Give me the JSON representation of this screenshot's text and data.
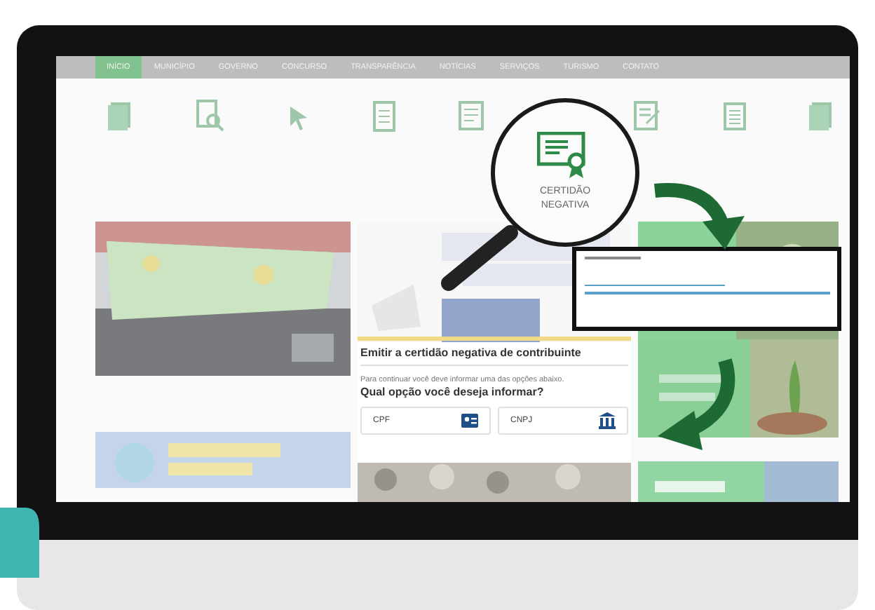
{
  "nav": [
    {
      "label": "INÍCIO",
      "selected": true
    },
    {
      "label": "MUNICÍPIO",
      "selected": false
    },
    {
      "label": "GOVERNO",
      "selected": false
    },
    {
      "label": "CONCURSO",
      "selected": false
    },
    {
      "label": "TRANSPARÊNCIA",
      "selected": false
    },
    {
      "label": "NOTÍCIAS",
      "selected": false
    },
    {
      "label": "SERVIÇOS",
      "selected": false
    },
    {
      "label": "TURISMO",
      "selected": false
    },
    {
      "label": "CONTATO",
      "selected": false
    }
  ],
  "magnified_item": {
    "label": "CERTIDÃO NEGATIVA"
  },
  "form": {
    "title": "Emitir a certidão negativa de contribuinte",
    "hint": "Para continuar você deve informar uma das opções abaixo.",
    "question": "Qual opção você deseja informar?",
    "options": [
      {
        "label": "CPF",
        "kind": "person"
      },
      {
        "label": "CNPJ",
        "kind": "company"
      }
    ]
  }
}
